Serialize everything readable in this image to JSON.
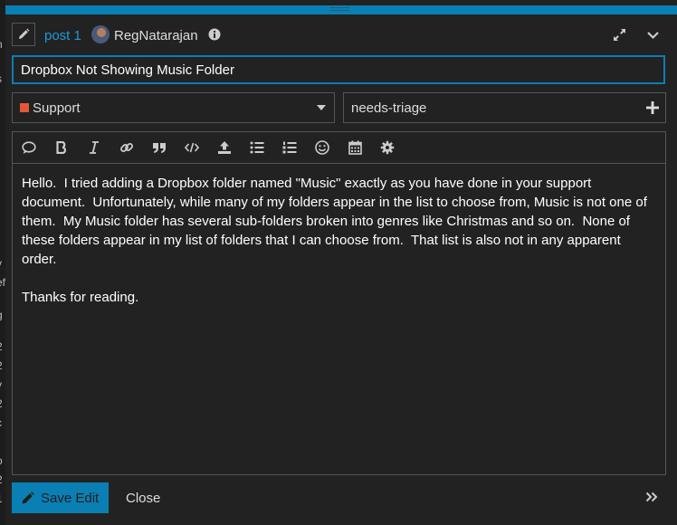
{
  "left_strip": {
    "fragments": [
      "n",
      "s",
      "t",
      "y",
      "ef",
      "g",
      "2",
      "2",
      "y",
      "2",
      "c",
      "-",
      "o",
      "2",
      "1"
    ]
  },
  "header": {
    "post_link": "post 1",
    "username": "RegNatarajan"
  },
  "title_input": {
    "value": "Dropbox Not Showing Music Folder"
  },
  "category": {
    "label": "Support",
    "color": "#e45735"
  },
  "tags": {
    "value": "needs-triage"
  },
  "editor": {
    "toolbar": [
      "quote-icon",
      "bold-icon",
      "italic-icon",
      "link-icon",
      "blockquote-icon",
      "code-icon",
      "upload-icon",
      "bullet-list-icon",
      "numbered-list-icon",
      "emoji-icon",
      "calendar-icon",
      "gear-icon"
    ],
    "body": "Hello.  I tried adding a Dropbox folder named \"Music\" exactly as you have done in your support document.  Unfortunately, while many of my folders appear in the list to choose from, Music is not one of them.  My Music folder has several sub-folders broken into genres like Christmas and so on.  None of these folders appear in my list of folders that I can choose from.  That list is also not in any apparent order.\n\nThanks for reading."
  },
  "footer": {
    "save_label": "Save Edit",
    "close_label": "Close"
  },
  "colors": {
    "accent": "#0a7fb3",
    "background": "#222222",
    "link": "#1e9bd8"
  }
}
